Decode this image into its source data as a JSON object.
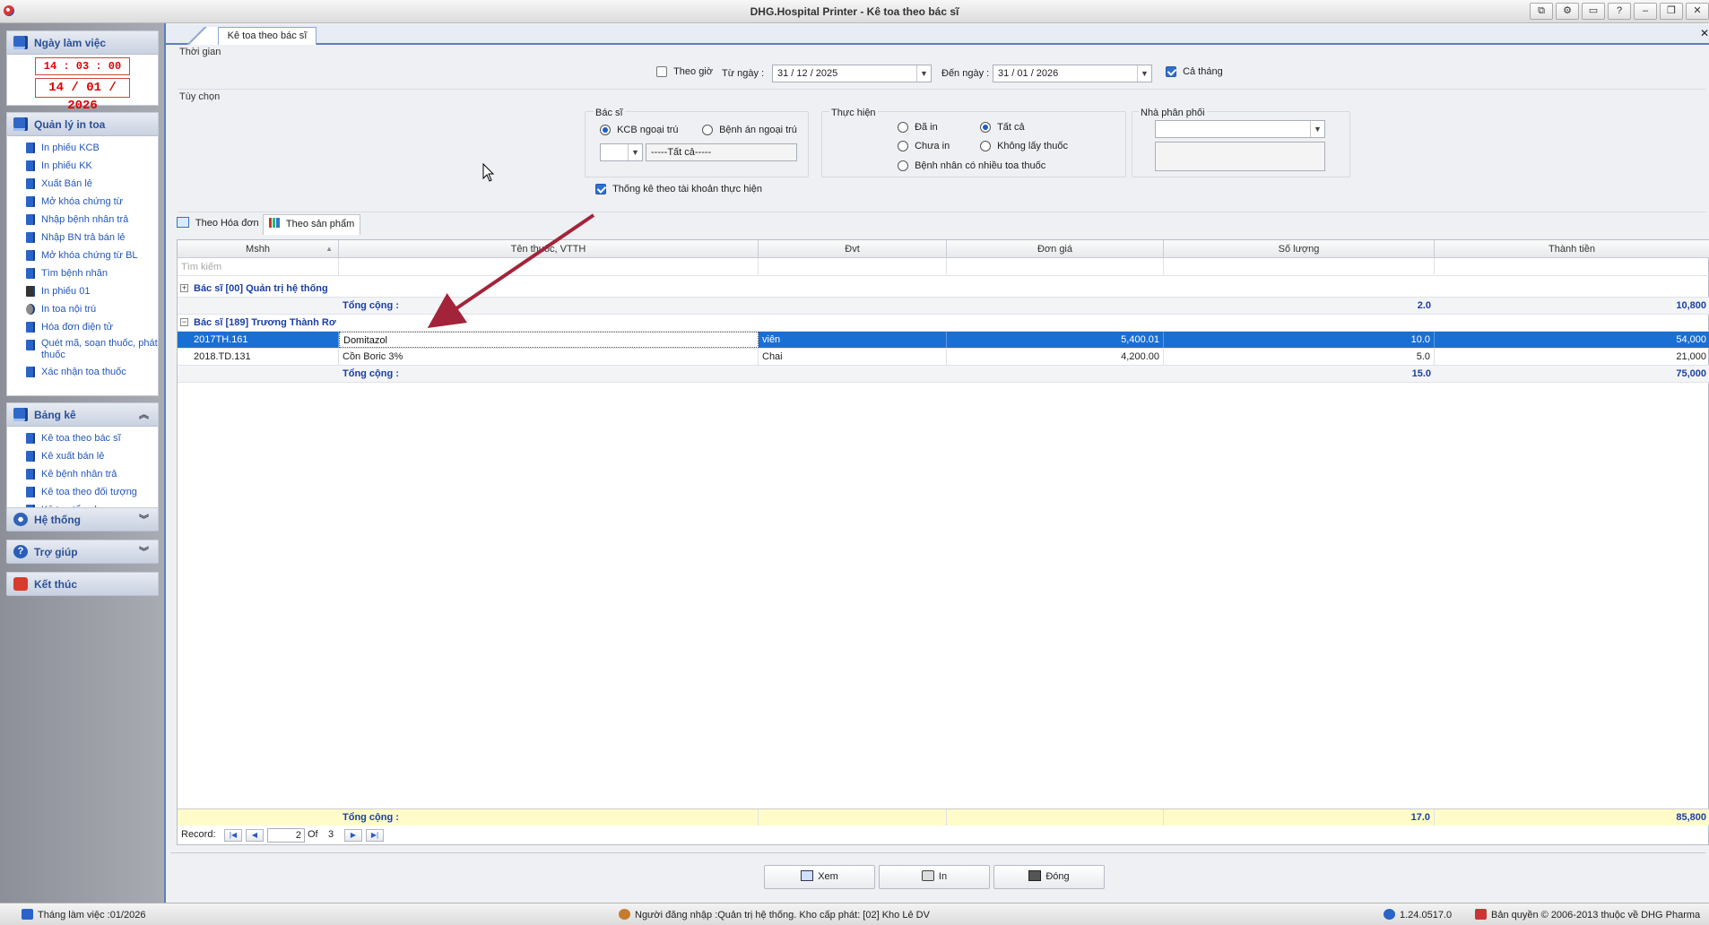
{
  "window": {
    "title": "DHG.Hospital Printer - Kê toa theo bác sĩ",
    "buttons": [
      "⧉",
      "⚙",
      "▭",
      "?",
      "–",
      "❐",
      "✕"
    ]
  },
  "nav": {
    "workday": {
      "title": "Ngày làm việc",
      "time": "14 : 03 : 00",
      "date": "14 / 01 / 2026"
    },
    "print_mgmt": {
      "title": "Quản lý in toa",
      "items": [
        {
          "label": "In phiếu KCB",
          "icon": "book-icon"
        },
        {
          "label": "In phiếu KK",
          "icon": "book-icon"
        },
        {
          "label": "Xuất Bán lẻ",
          "icon": "book-icon"
        },
        {
          "label": "Mở khóa chứng từ",
          "icon": "book-icon"
        },
        {
          "label": "Nhập bệnh nhân trả",
          "icon": "book-icon"
        },
        {
          "label": "Nhập BN trả bán lẻ",
          "icon": "book-icon"
        },
        {
          "label": "Mở khóa chứng từ BL",
          "icon": "book-icon"
        },
        {
          "label": "Tìm bệnh nhân",
          "icon": "book-icon"
        },
        {
          "label": "In phiếu 01",
          "icon": "floppy-icon"
        },
        {
          "label": "In toa nội trú",
          "icon": "printer-icon"
        },
        {
          "label": "Hóa đơn điện tử",
          "icon": "book-icon"
        },
        {
          "label": "Quét mã, soạn thuốc, phát thuốc",
          "icon": "book-icon"
        },
        {
          "label": "Xác nhận toa thuốc",
          "icon": "book-icon"
        }
      ]
    },
    "reports": {
      "title": "Bảng kê",
      "items": [
        {
          "label": "Kê toa theo bác sĩ"
        },
        {
          "label": "Kê xuất bán lẻ"
        },
        {
          "label": "Kê bệnh nhân trả"
        },
        {
          "label": "Kê toa theo đối tượng"
        },
        {
          "label": "Kê toa tổng hợp"
        }
      ]
    },
    "system": {
      "title": "Hệ thống"
    },
    "help": {
      "title": "Trợ giúp"
    },
    "exit": {
      "title": "Kết thúc"
    }
  },
  "tab": {
    "label": "Kê toa theo bác sĩ"
  },
  "filters": {
    "time_group": "Thời gian",
    "by_hour_label": "Theo giờ",
    "from_label": "Từ ngày :",
    "from_value": "31 / 12 / 2025",
    "to_label": "Đến ngày :",
    "to_value": "31 / 01 / 2026",
    "whole_month_label": "Cả tháng",
    "options_group": "Tùy chọn",
    "doctor_group": "Bác sĩ",
    "doctor_opt1": "KCB ngoại trú",
    "doctor_opt2": "Bệnh án ngoại trú",
    "doctor_select": "-----Tất cả-----",
    "exec_group": "Thực hiện",
    "exec_printed": "Đã in",
    "exec_all": "Tất cả",
    "exec_not_printed": "Chưa in",
    "exec_no_take": "Không lấy thuốc",
    "exec_multi": "Bệnh nhân có nhiều toa thuốc",
    "dist_group": "Nhà phân phối",
    "stat_by_account": "Thống kê theo tài khoản thực hiện"
  },
  "subtabs": [
    {
      "label": "Theo Hóa đơn"
    },
    {
      "label": "Theo sản phẩm"
    }
  ],
  "grid": {
    "columns": [
      "Mshh",
      "Tên thuốc, VTTH",
      "Đvt",
      "Đơn giá",
      "Số lượng",
      "Thành tiền"
    ],
    "search_placeholder": "Tìm kiếm",
    "groups": [
      {
        "title": "Bác sĩ  [00] Quản trị hệ thống",
        "collapsed": true,
        "total_label": "Tổng cộng :",
        "total_qty": "2.0",
        "total_amount": "10,800",
        "rows": []
      },
      {
        "title": "Bác sĩ  [189] Trương Thành Rơ",
        "collapsed": false,
        "total_label": "Tổng cộng :",
        "total_qty": "15.0",
        "total_amount": "75,000",
        "rows": [
          {
            "code": "2017TH.161",
            "name": "Domitazol",
            "unit": "viên",
            "price": "5,400.01",
            "qty": "10.0",
            "amount": "54,000",
            "selected": true
          },
          {
            "code": "2018.TD.131",
            "name": "Cồn Boric 3%",
            "unit": "Chai",
            "price": "4,200.00",
            "qty": "5.0",
            "amount": "21,000",
            "selected": false
          }
        ]
      }
    ],
    "grand_total_label": "Tổng cộng :",
    "grand_total_qty": "17.0",
    "grand_total_amount": "85,800",
    "record_label": "Record:",
    "record_current": "2",
    "record_of": "Of",
    "record_total": "3"
  },
  "actions": {
    "view": "Xem",
    "print": "In",
    "close": "Đóng"
  },
  "status": {
    "month": "Tháng làm việc :01/2026",
    "user": "Người đăng nhập :Quản trị hệ thống. Kho cấp phát: [02] Kho Lẻ DV",
    "version": "1.24.0517.0",
    "copyright": "Bản quyền © 2006-2013 thuộc về DHG Pharma"
  },
  "colors": {
    "accent": "#2a4f98",
    "selection": "#1a6fd4",
    "clock": "#dd0000",
    "annotation_arrow": "#a3243a"
  }
}
